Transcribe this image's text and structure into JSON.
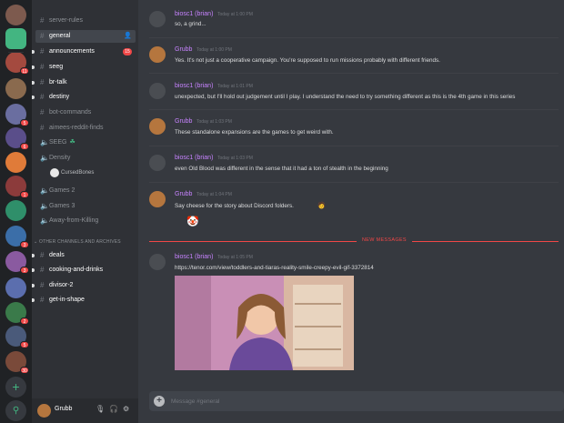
{
  "servers": [
    {
      "name": "server-1",
      "color": "#7d5a4e",
      "badge": ""
    },
    {
      "name": "server-active",
      "color": "#43b581",
      "badge": ""
    },
    {
      "name": "server-3",
      "color": "#a44a3f",
      "badge": "11"
    },
    {
      "name": "server-4",
      "color": "#8a6a4e",
      "badge": ""
    },
    {
      "name": "server-5",
      "color": "#6a6ea0",
      "badge": "5"
    },
    {
      "name": "server-6",
      "color": "#5a4e8a",
      "badge": "6"
    },
    {
      "name": "server-7",
      "color": "#e07b39",
      "badge": ""
    },
    {
      "name": "server-8",
      "color": "#8c3b3b",
      "badge": "1"
    },
    {
      "name": "server-9",
      "color": "#2f8f6a",
      "badge": ""
    },
    {
      "name": "server-10",
      "color": "#3b6ea8",
      "badge": "3"
    },
    {
      "name": "server-11",
      "color": "#8a5aa0",
      "badge": "3"
    },
    {
      "name": "server-12",
      "color": "#5b6eae",
      "badge": ""
    },
    {
      "name": "server-13",
      "color": "#3a7a4a",
      "badge": "2"
    },
    {
      "name": "server-14",
      "color": "#4a5a7a",
      "badge": "5"
    },
    {
      "name": "server-15",
      "color": "#7a4a3a",
      "badge": "30"
    }
  ],
  "channels": {
    "server_rules": "server-rules",
    "general": "general",
    "announcements": "announcements",
    "announcements_badge": "15",
    "seeg": "seeg",
    "br_talk": "br-talk",
    "destiny": "destiny",
    "bot_commands": "bot-commands",
    "aimees_reddit_finds": "aimees-reddit-finds",
    "voice_seeg": "SEEG",
    "voice_density": "Density",
    "voice_user": "CursedBones",
    "voice_games2": "Games 2",
    "voice_games3": "Games 3",
    "voice_afk": "Away-from-Killing",
    "category_other": "OTHER CHANNELS AND ARCHIVES",
    "deals": "deals",
    "cooking": "cooking-and-drinks",
    "divisor": "divisor-2",
    "get_in_shape": "get-in-shape"
  },
  "user": {
    "name": "Grubb"
  },
  "messages": [
    {
      "author": "biosc1 (brian)",
      "time": "Today at 1:00 PM",
      "text": "so, a grind..."
    },
    {
      "author": "Grubb",
      "time": "Today at 1:00 PM",
      "text": "Yes. It's not just a cooperative campaign. You're supposed to run missions probably with different friends."
    },
    {
      "author": "biosc1 (brian)",
      "time": "Today at 1:01 PM",
      "text": "unexpected, but I'll hold out judgement until I play.  I understand the need to try something different as this is the 4th game in this series"
    },
    {
      "author": "Grubb",
      "time": "Today at 1:03 PM",
      "text": "These standalone expansions are the games to get weird with."
    },
    {
      "author": "biosc1 (brian)",
      "time": "Today at 1:03 PM",
      "text": "even Old Blood was different in the sense that it had a ton of stealth in the beginning"
    },
    {
      "author": "Grubb",
      "time": "Today at 1:04 PM",
      "text": "Say cheese for the story about Discord folders."
    },
    {
      "author": "biosc1 (brian)",
      "time": "Today at 1:05 PM",
      "text": "https://tenor.com/view/toddlers-and-tiaras-reality-smile-creepy-evil-gif-3372814"
    }
  ],
  "new_messages_label": "NEW MESSAGES",
  "composer": {
    "placeholder": "Message #general"
  }
}
